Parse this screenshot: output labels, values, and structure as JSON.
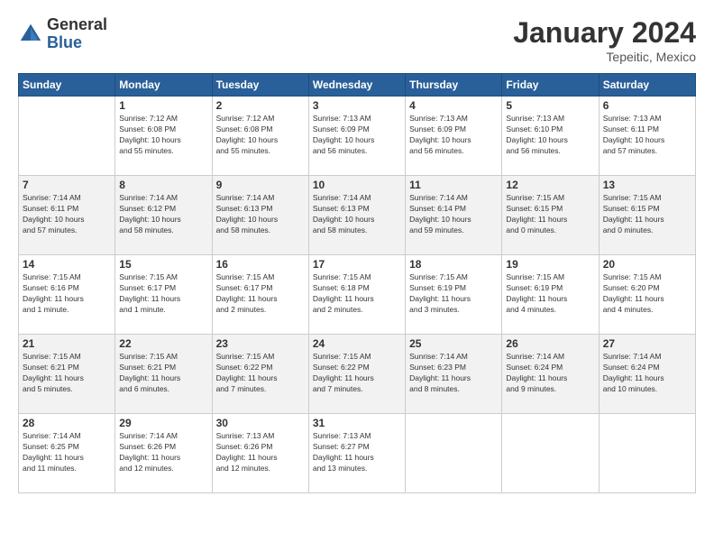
{
  "header": {
    "logo_general": "General",
    "logo_blue": "Blue",
    "month_title": "January 2024",
    "location": "Tepeitic, Mexico"
  },
  "weekdays": [
    "Sunday",
    "Monday",
    "Tuesday",
    "Wednesday",
    "Thursday",
    "Friday",
    "Saturday"
  ],
  "weeks": [
    [
      {
        "day": "",
        "info": ""
      },
      {
        "day": "1",
        "info": "Sunrise: 7:12 AM\nSunset: 6:08 PM\nDaylight: 10 hours\nand 55 minutes."
      },
      {
        "day": "2",
        "info": "Sunrise: 7:12 AM\nSunset: 6:08 PM\nDaylight: 10 hours\nand 55 minutes."
      },
      {
        "day": "3",
        "info": "Sunrise: 7:13 AM\nSunset: 6:09 PM\nDaylight: 10 hours\nand 56 minutes."
      },
      {
        "day": "4",
        "info": "Sunrise: 7:13 AM\nSunset: 6:09 PM\nDaylight: 10 hours\nand 56 minutes."
      },
      {
        "day": "5",
        "info": "Sunrise: 7:13 AM\nSunset: 6:10 PM\nDaylight: 10 hours\nand 56 minutes."
      },
      {
        "day": "6",
        "info": "Sunrise: 7:13 AM\nSunset: 6:11 PM\nDaylight: 10 hours\nand 57 minutes."
      }
    ],
    [
      {
        "day": "7",
        "info": "Sunrise: 7:14 AM\nSunset: 6:11 PM\nDaylight: 10 hours\nand 57 minutes."
      },
      {
        "day": "8",
        "info": "Sunrise: 7:14 AM\nSunset: 6:12 PM\nDaylight: 10 hours\nand 58 minutes."
      },
      {
        "day": "9",
        "info": "Sunrise: 7:14 AM\nSunset: 6:13 PM\nDaylight: 10 hours\nand 58 minutes."
      },
      {
        "day": "10",
        "info": "Sunrise: 7:14 AM\nSunset: 6:13 PM\nDaylight: 10 hours\nand 58 minutes."
      },
      {
        "day": "11",
        "info": "Sunrise: 7:14 AM\nSunset: 6:14 PM\nDaylight: 10 hours\nand 59 minutes."
      },
      {
        "day": "12",
        "info": "Sunrise: 7:15 AM\nSunset: 6:15 PM\nDaylight: 11 hours\nand 0 minutes."
      },
      {
        "day": "13",
        "info": "Sunrise: 7:15 AM\nSunset: 6:15 PM\nDaylight: 11 hours\nand 0 minutes."
      }
    ],
    [
      {
        "day": "14",
        "info": "Sunrise: 7:15 AM\nSunset: 6:16 PM\nDaylight: 11 hours\nand 1 minute."
      },
      {
        "day": "15",
        "info": "Sunrise: 7:15 AM\nSunset: 6:17 PM\nDaylight: 11 hours\nand 1 minute."
      },
      {
        "day": "16",
        "info": "Sunrise: 7:15 AM\nSunset: 6:17 PM\nDaylight: 11 hours\nand 2 minutes."
      },
      {
        "day": "17",
        "info": "Sunrise: 7:15 AM\nSunset: 6:18 PM\nDaylight: 11 hours\nand 2 minutes."
      },
      {
        "day": "18",
        "info": "Sunrise: 7:15 AM\nSunset: 6:19 PM\nDaylight: 11 hours\nand 3 minutes."
      },
      {
        "day": "19",
        "info": "Sunrise: 7:15 AM\nSunset: 6:19 PM\nDaylight: 11 hours\nand 4 minutes."
      },
      {
        "day": "20",
        "info": "Sunrise: 7:15 AM\nSunset: 6:20 PM\nDaylight: 11 hours\nand 4 minutes."
      }
    ],
    [
      {
        "day": "21",
        "info": "Sunrise: 7:15 AM\nSunset: 6:21 PM\nDaylight: 11 hours\nand 5 minutes."
      },
      {
        "day": "22",
        "info": "Sunrise: 7:15 AM\nSunset: 6:21 PM\nDaylight: 11 hours\nand 6 minutes."
      },
      {
        "day": "23",
        "info": "Sunrise: 7:15 AM\nSunset: 6:22 PM\nDaylight: 11 hours\nand 7 minutes."
      },
      {
        "day": "24",
        "info": "Sunrise: 7:15 AM\nSunset: 6:22 PM\nDaylight: 11 hours\nand 7 minutes."
      },
      {
        "day": "25",
        "info": "Sunrise: 7:14 AM\nSunset: 6:23 PM\nDaylight: 11 hours\nand 8 minutes."
      },
      {
        "day": "26",
        "info": "Sunrise: 7:14 AM\nSunset: 6:24 PM\nDaylight: 11 hours\nand 9 minutes."
      },
      {
        "day": "27",
        "info": "Sunrise: 7:14 AM\nSunset: 6:24 PM\nDaylight: 11 hours\nand 10 minutes."
      }
    ],
    [
      {
        "day": "28",
        "info": "Sunrise: 7:14 AM\nSunset: 6:25 PM\nDaylight: 11 hours\nand 11 minutes."
      },
      {
        "day": "29",
        "info": "Sunrise: 7:14 AM\nSunset: 6:26 PM\nDaylight: 11 hours\nand 12 minutes."
      },
      {
        "day": "30",
        "info": "Sunrise: 7:13 AM\nSunset: 6:26 PM\nDaylight: 11 hours\nand 12 minutes."
      },
      {
        "day": "31",
        "info": "Sunrise: 7:13 AM\nSunset: 6:27 PM\nDaylight: 11 hours\nand 13 minutes."
      },
      {
        "day": "",
        "info": ""
      },
      {
        "day": "",
        "info": ""
      },
      {
        "day": "",
        "info": ""
      }
    ]
  ]
}
